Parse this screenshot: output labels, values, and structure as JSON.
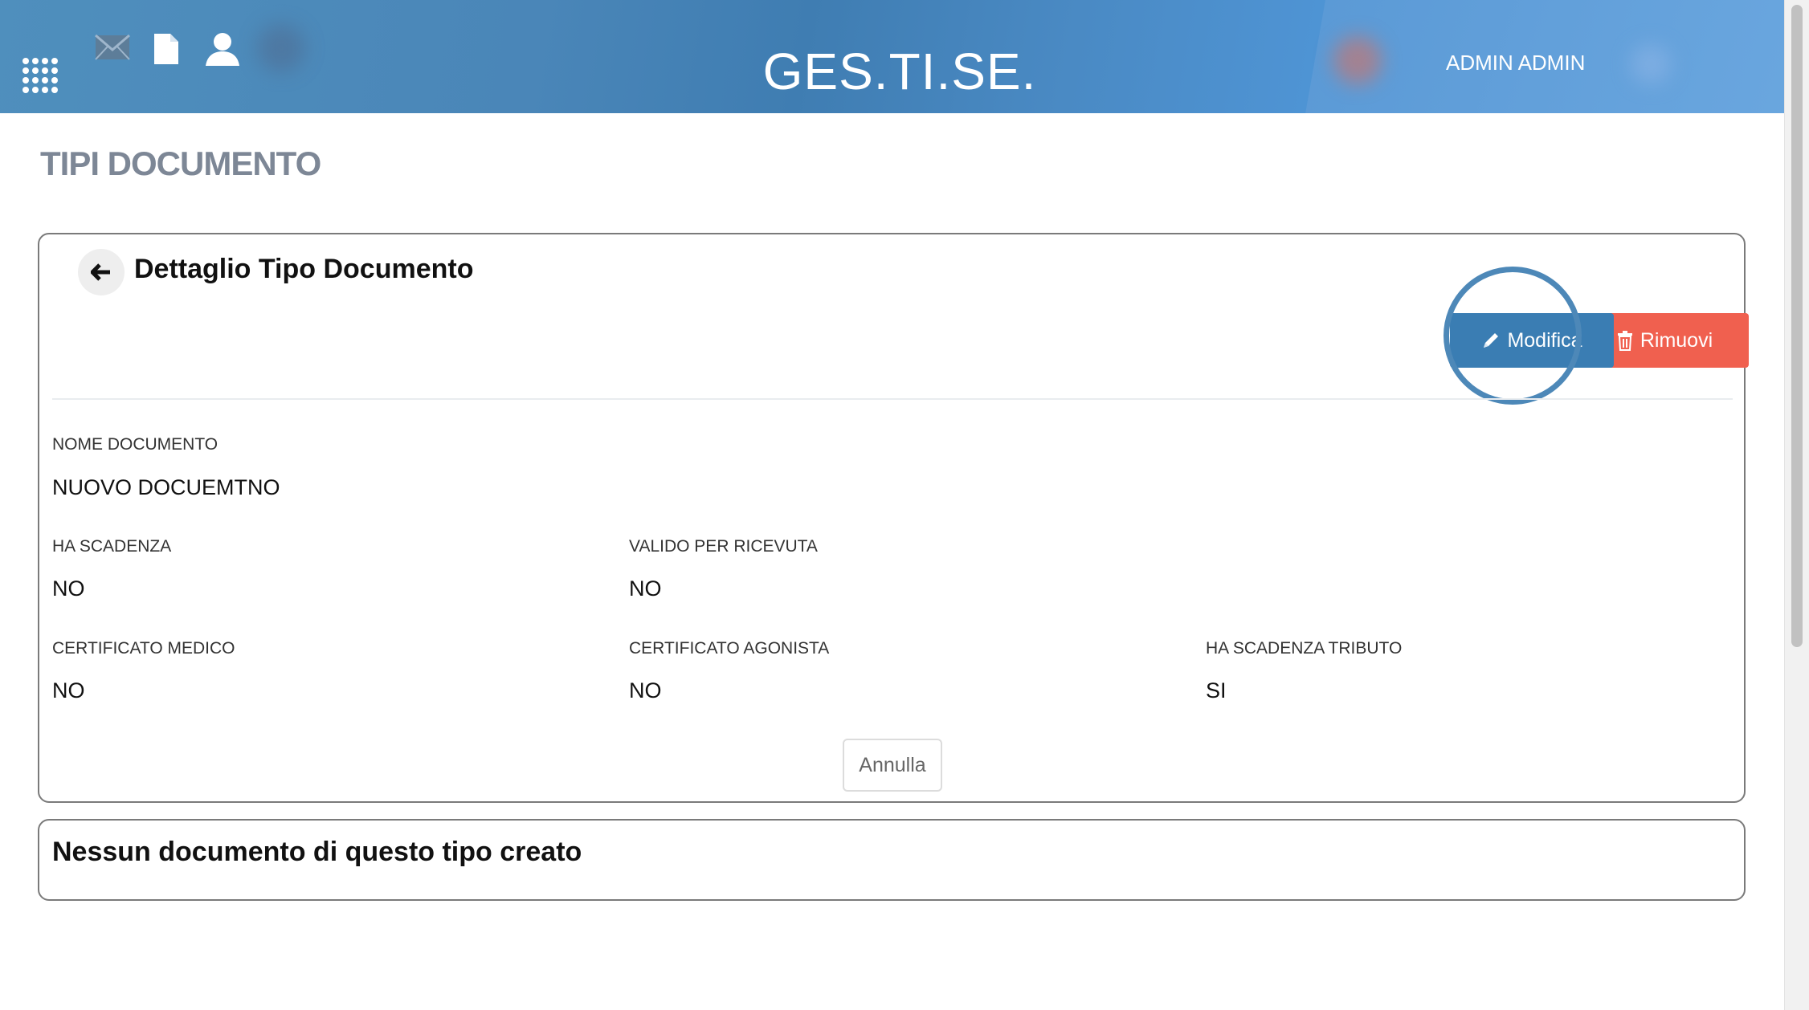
{
  "header": {
    "app_title": "GES.TI.SE.",
    "user_name": "ADMIN ADMIN",
    "icons": [
      "apps-grid-icon",
      "mail-icon",
      "document-icon",
      "user-icon"
    ]
  },
  "page": {
    "title": "TIPI DOCUMENTO"
  },
  "detail": {
    "title": "Dettaglio Tipo Documento",
    "edit_label": "Modifica",
    "remove_label": "Rimuovi",
    "cancel_label": "Annulla",
    "fields": {
      "nome_documento": {
        "label": "NOME DOCUMENTO",
        "value": "NUOVO DOCUEMTNO"
      },
      "ha_scadenza": {
        "label": "HA SCADENZA",
        "value": "NO"
      },
      "valido_per_ricevuta": {
        "label": "VALIDO PER RICEVUTA",
        "value": "NO"
      },
      "certificato_medico": {
        "label": "CERTIFICATO MEDICO",
        "value": "NO"
      },
      "certificato_agonista": {
        "label": "CERTIFICATO AGONISTA",
        "value": "NO"
      },
      "ha_scadenza_tributo": {
        "label": "HA SCADENZA TRIBUTO",
        "value": "SI"
      }
    }
  },
  "documents": {
    "empty_message": "Nessun documento di questo tipo creato"
  },
  "colors": {
    "primary": "#3a7db3",
    "danger": "#f0604f",
    "page_title": "#7d8796"
  }
}
